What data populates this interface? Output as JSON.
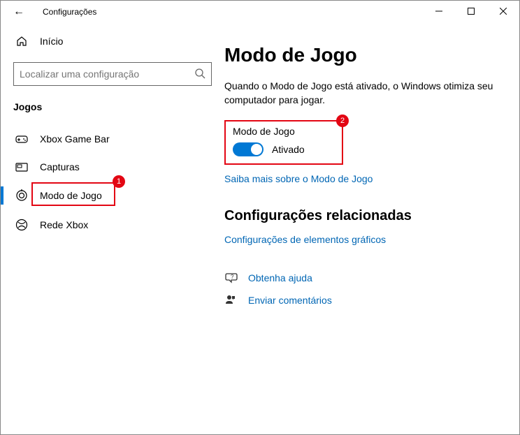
{
  "window": {
    "title": "Configurações"
  },
  "sidebar": {
    "home": "Início",
    "search_placeholder": "Localizar uma configuração",
    "section": "Jogos",
    "items": [
      {
        "label": "Xbox Game Bar"
      },
      {
        "label": "Capturas"
      },
      {
        "label": "Modo de Jogo"
      },
      {
        "label": "Rede Xbox"
      }
    ]
  },
  "annotations": {
    "badge1": "1",
    "badge2": "2"
  },
  "main": {
    "heading": "Modo de Jogo",
    "description": "Quando o Modo de Jogo está ativado, o Windows otimiza seu computador para jogar.",
    "toggle_label": "Modo de Jogo",
    "toggle_state": "Ativado",
    "learn_more": "Saiba mais sobre o Modo de Jogo",
    "related_heading": "Configurações relacionadas",
    "related_link": "Configurações de elementos gráficos",
    "help": "Obtenha ajuda",
    "feedback": "Enviar comentários"
  }
}
